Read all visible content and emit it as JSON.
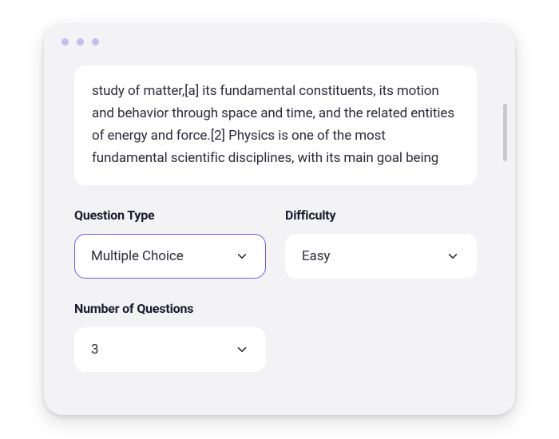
{
  "source_text": "study of matter,[a] its fundamental constituents, its motion and behavior through  space and time, and the related entities of energy and force.[2] Physics is one of the most fundamental scientific disciplines, with its main goal being",
  "fields": {
    "question_type": {
      "label": "Question Type",
      "value": "Multiple Choice"
    },
    "difficulty": {
      "label": "Difficulty",
      "value": "Easy"
    },
    "num_questions": {
      "label": "Number of Questions",
      "value": "3"
    }
  },
  "colors": {
    "accent": "#6b5ce7",
    "dot": "#c4bdf3"
  }
}
